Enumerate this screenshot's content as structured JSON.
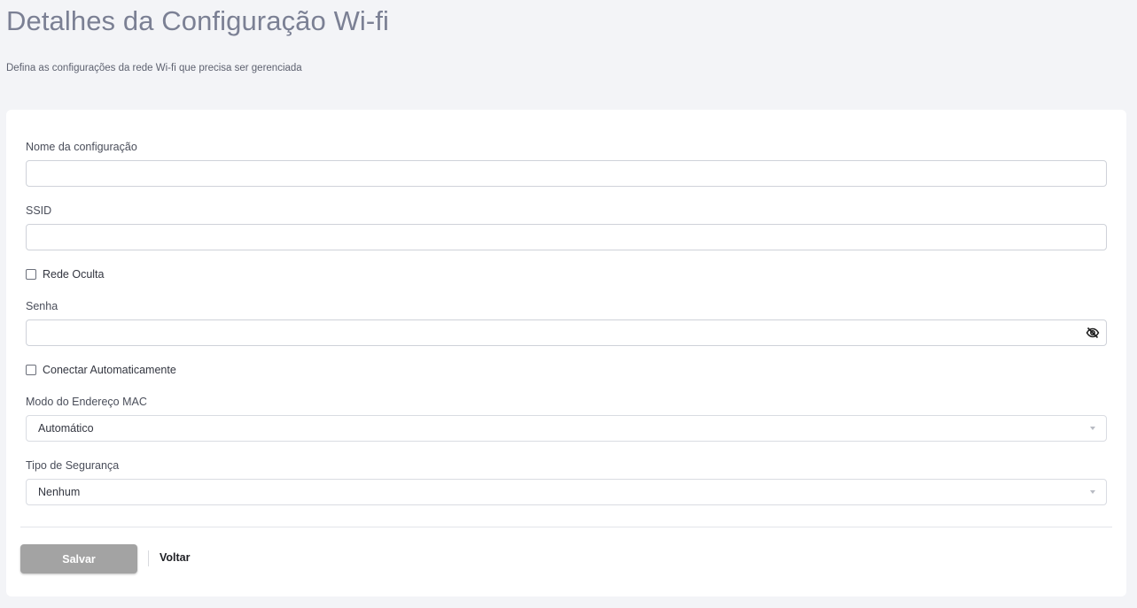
{
  "header": {
    "title": "Detalhes da Configuração Wi-fi",
    "subtitle": "Defina as configurações da rede Wi-fi que precisa ser gerenciada"
  },
  "form": {
    "config_name": {
      "label": "Nome da configuração",
      "value": ""
    },
    "ssid": {
      "label": "SSID",
      "value": ""
    },
    "hidden_network": {
      "label": "Rede Oculta",
      "checked": false
    },
    "password": {
      "label": "Senha",
      "value": "",
      "icon": "eye-off-icon"
    },
    "auto_connect": {
      "label": "Conectar Automaticamente",
      "checked": false
    },
    "mac_mode": {
      "label": "Modo do Endereço MAC",
      "selected": "Automático"
    },
    "security_type": {
      "label": "Tipo de Segurança",
      "selected": "Nenhum"
    }
  },
  "actions": {
    "save_label": "Salvar",
    "back_label": "Voltar"
  },
  "colors": {
    "page_bg": "#f3f4f7",
    "card_bg": "#ffffff",
    "title": "#7b8094",
    "save_button_bg": "#a3a3a3"
  }
}
